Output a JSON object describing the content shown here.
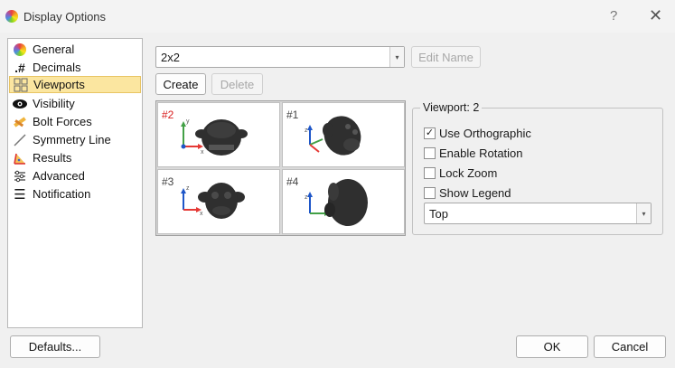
{
  "window": {
    "title": "Display Options",
    "help_glyph": "?",
    "close_glyph": "✕"
  },
  "sidebar": {
    "items": [
      {
        "label": "General",
        "icon": "color-wheel-icon"
      },
      {
        "label": "Decimals",
        "icon": "decimals-icon",
        "glyph": ".#"
      },
      {
        "label": "Viewports",
        "icon": "viewports-icon",
        "selected": true
      },
      {
        "label": "Visibility",
        "icon": "eye-icon"
      },
      {
        "label": "Bolt Forces",
        "icon": "ruler-pencil-icon"
      },
      {
        "label": "Symmetry Line",
        "icon": "line-icon"
      },
      {
        "label": "Results",
        "icon": "results-icon"
      },
      {
        "label": "Advanced",
        "icon": "sliders-icon"
      },
      {
        "label": "Notification",
        "icon": "menu-lines-icon",
        "glyph": "☰"
      }
    ]
  },
  "layout": {
    "selected": "2x2",
    "edit_name_label": "Edit Name",
    "create_label": "Create",
    "delete_label": "Delete",
    "dropdown_glyph": "▾"
  },
  "viewports": [
    {
      "number": "#2",
      "active": true,
      "view": "top"
    },
    {
      "number": "#1",
      "active": false,
      "view": "iso"
    },
    {
      "number": "#3",
      "active": false,
      "view": "front"
    },
    {
      "number": "#4",
      "active": false,
      "view": "side"
    }
  ],
  "viewport_settings": {
    "title": "Viewport: 2",
    "options": [
      {
        "label": "Use Orthographic",
        "checked": true
      },
      {
        "label": "Enable Rotation",
        "checked": false
      },
      {
        "label": "Lock Zoom",
        "checked": false
      },
      {
        "label": "Show Legend",
        "checked": false
      }
    ],
    "view_value": "Top",
    "check_glyph": "✓"
  },
  "footer": {
    "defaults_label": "Defaults...",
    "ok_label": "OK",
    "cancel_label": "Cancel"
  },
  "axis_labels": {
    "x": "x",
    "y": "y",
    "z": "z"
  },
  "colors": {
    "selection_bg": "#fbe6a0",
    "active_viewport": "#d81b1b",
    "axis_x": "#e53935",
    "axis_y": "#43a047",
    "axis_z": "#1e56c8",
    "mesh": "#2f2f2f"
  }
}
